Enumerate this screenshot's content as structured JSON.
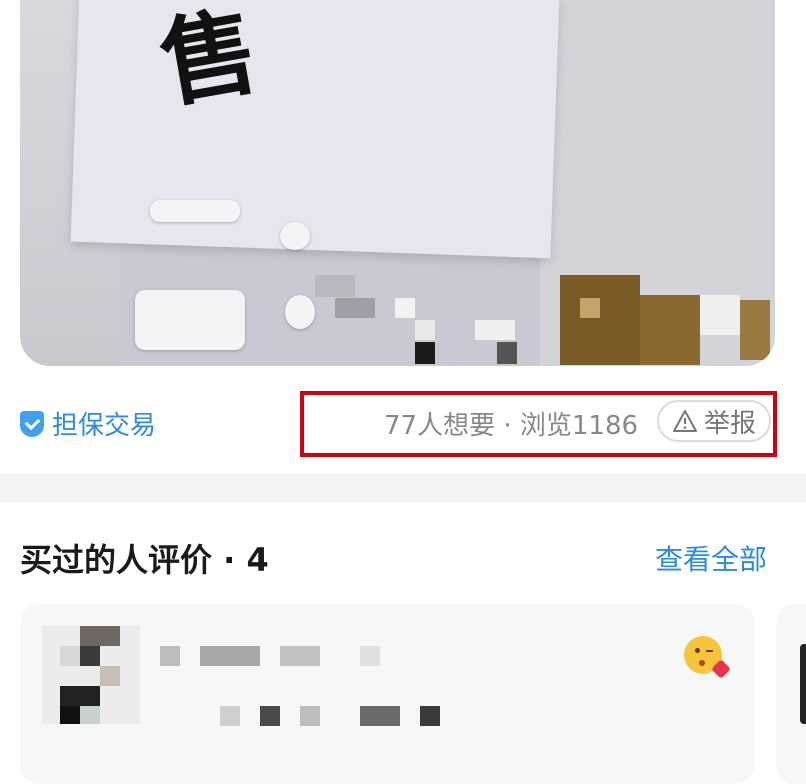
{
  "listing": {
    "guarantee_label": "担保交易",
    "stats_text": "77人想要 · 浏览1186",
    "report_label": "举报",
    "photo_sign_char": "售"
  },
  "reviews": {
    "title": "买过的人评价 · 4",
    "view_all_label": "查看全部"
  },
  "icons": {
    "guarantee": "shield-check-icon",
    "report": "warning-triangle-icon",
    "reaction": "kiss-emoji-icon"
  },
  "colors": {
    "accent": "#2b89e8",
    "highlight_box": "#d40012",
    "muted_text": "#888888"
  }
}
